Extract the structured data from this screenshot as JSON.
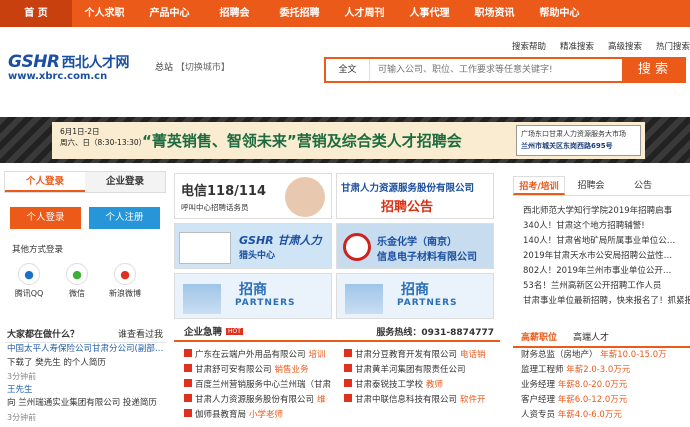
{
  "nav": [
    "首 页",
    "个人求职",
    "产品中心",
    "招聘会",
    "委托招聘",
    "人才周刊",
    "人事代理",
    "职场资讯",
    "帮助中心"
  ],
  "toplinks": [
    "搜索帮助",
    "精准搜索",
    "高级搜索",
    "热门搜索"
  ],
  "logo": {
    "brand": "GSHR",
    "name": "西北人才网",
    "url": "www.xbrc.com.cn"
  },
  "city": {
    "label": "总站",
    "switch": "【切换城市】"
  },
  "search": {
    "select": "全文",
    "placeholder": "可输入公司、职位、工作要求等任意关键字!",
    "button": "搜 索"
  },
  "banner": {
    "date": "6月1日-2日",
    "date2": "周六、日（8:30-13:30）",
    "title": "“菁英销售、智领未来”营销及综合类人才招聘会",
    "loc1": "广场东口甘肃人力资源服务大市场",
    "loc2": "兰州市城关区东岗西路695号"
  },
  "login": {
    "tab1": "个人登录",
    "tab2": "企业登录",
    "btn_login": "个人登录",
    "btn_reg": "个人注册",
    "other": "其他方式登录",
    "icons": [
      {
        "icon": "qq-icon",
        "label": "腾讯QQ"
      },
      {
        "icon": "wechat-icon",
        "label": "微信"
      },
      {
        "icon": "weibo-icon",
        "label": "新浪微博"
      }
    ]
  },
  "news": {
    "title": "大家都在做什么？",
    "more": "谁查看过我",
    "rows": [
      {
        "a": "中国太平人寿保险公司甘肃分公司(副部…",
        "b": "下载了 樊先生 的个人简历",
        "c": "3分钟前"
      },
      {
        "a": "王先生",
        "b": "向 兰州瑞通实业集团有限公司 投递简历",
        "c": "3分钟前"
      }
    ]
  },
  "ads": [
    {
      "t1": "电信118/114",
      "t2": "呼叫中心招聘话务员"
    },
    {
      "t1": "甘肃人力资源服务股份有限公司",
      "t2": "招聘公告"
    },
    {
      "t1": "GSHR 甘肃人力",
      "t2": "猎头中心"
    },
    {
      "t1": "乐金化学（南京）",
      "t2": "信息电子材料有限公司"
    },
    {
      "t1": "招商",
      "t2": "PARTNERS"
    },
    {
      "t1": "招商",
      "t2": "PARTNERS"
    }
  ],
  "jobs": {
    "title": "企业急聘",
    "hot": "HOT",
    "tel": "服务热线：0931-8874777",
    "rows": [
      {
        "co": "广东在云端户外用品有限公司",
        "pos": "培训"
      },
      {
        "co": "甘肃分豆教育开发有限公司",
        "pos": "电话销"
      },
      {
        "co": "甘肃舒可安有限公司",
        "pos": "销售业务"
      },
      {
        "co": "甘肃黄羊河集团有限责任公司",
        "pos": ""
      },
      {
        "co": "百度兰州营销服务中心兰州瑞（甘肃",
        "pos": ""
      },
      {
        "co": "甘肃泰锐技工学校",
        "pos": "教师"
      },
      {
        "co": "甘肃人力资源服务股份有限公司",
        "pos": "维"
      },
      {
        "co": "甘肃中联信息科技有限公司",
        "pos": "软件开"
      },
      {
        "co": "伽师县教育局",
        "pos": "小学老师"
      }
    ]
  },
  "right": {
    "tabs": [
      "招考/培训",
      "招聘会",
      "公告"
    ],
    "items": [
      "西北师范大学知行学院2019年招聘启事",
      "340人！甘肃这个地方招聘辅警!",
      "140人！甘肃省地矿局所属事业单位公…",
      "2019年甘肃天水市公安局招聘公益性…",
      "802人！2019年兰州市事业单位公开…",
      "53名！兰州高新区公开招聘工作人员",
      "甘肃事业单位最新招聘，快来报名了！抓紧报…"
    ]
  },
  "right2": {
    "tabs": [
      "高薪职位",
      "高端人才"
    ],
    "rows": [
      {
        "job": "财务总监（房地产）",
        "sal": "年薪10.0-15.0万"
      },
      {
        "job": "监理工程师",
        "sal": "年薪2.0-3.0万元"
      },
      {
        "job": "业务经理",
        "sal": "年薪8.0-20.0万元"
      },
      {
        "job": "客户经理",
        "sal": "年薪6.0-12.0万元"
      },
      {
        "job": "人资专员",
        "sal": "年薪4.0-6.0万元"
      }
    ]
  }
}
